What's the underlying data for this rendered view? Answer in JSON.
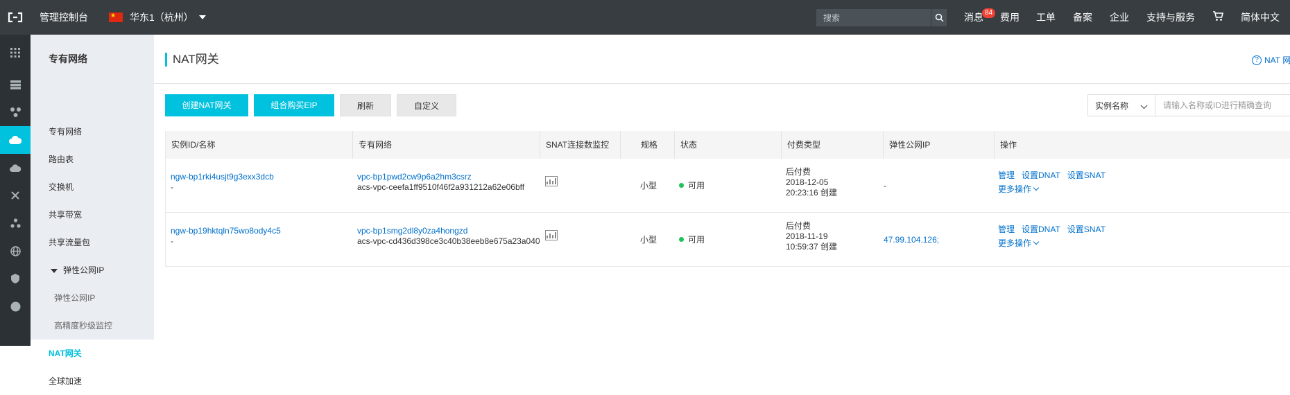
{
  "topbar": {
    "console_label": "管理控制台",
    "region_label": "华东1（杭州）",
    "search_placeholder": "搜索",
    "nav": {
      "messages": "消息",
      "messages_badge": "84",
      "fees": "费用",
      "tickets": "工单",
      "filing": "备案",
      "enterprise": "企业",
      "support": "支持与服务",
      "language": "简体中文"
    },
    "colors": {
      "background": "#373d41",
      "badge": "#f04134"
    }
  },
  "rail": {
    "icons": [
      "apps-grid-icon",
      "server-icon",
      "network-icon",
      "cloud-icon",
      "cdn-icon",
      "tools-icon",
      "cluster-icon",
      "globe-icon",
      "security-icon",
      "circle-icon"
    ],
    "active_index": 3,
    "accent": "#00c1de"
  },
  "sidebar": {
    "title": "专有网络",
    "items": [
      {
        "label": "专有网络"
      },
      {
        "label": "路由表"
      },
      {
        "label": "交换机"
      },
      {
        "label": "共享带宽"
      },
      {
        "label": "共享流量包"
      },
      {
        "label": "弹性公网IP"
      },
      {
        "label": "弹性公网IP"
      },
      {
        "label": "高精度秒级监控"
      },
      {
        "label": "NAT网关"
      },
      {
        "label": "全球加速"
      }
    ]
  },
  "main": {
    "title": "NAT网关",
    "help_link": "NAT 网",
    "buttons": {
      "create": "创建NAT网关",
      "buy_eip": "组合购买EIP",
      "refresh": "刷新",
      "customize": "自定义"
    },
    "filter": {
      "select_value": "实例名称",
      "input_placeholder": "请输入名称或ID进行精确查询"
    },
    "table": {
      "columns": [
        "实例ID/名称",
        "专有网络",
        "SNAT连接数监控",
        "规格",
        "状态",
        "付费类型",
        "弹性公网IP",
        "操作"
      ],
      "rows": [
        {
          "id": "ngw-bp1rki4usjt9g3exx3dcb",
          "name": "-",
          "vpc_id": "vpc-bp1pwd2cw9p6a2hm3csrz",
          "vpc_name": "acs-vpc-ceefa1ff9510f46f2a931212a62e06bff",
          "spec": "小型",
          "status": "可用",
          "billing": "后付费",
          "created_date": "2018-12-05",
          "created_time": "20:23:16 创建",
          "eip": "-",
          "ops": {
            "manage": "管理",
            "dnat": "设置DNAT",
            "snat": "设置SNAT",
            "more": "更多操作"
          }
        },
        {
          "id": "ngw-bp19hktqln75wo8ody4c5",
          "name": "-",
          "vpc_id": "vpc-bp1smg2dl8y0za4hongzd",
          "vpc_name": "acs-vpc-cd436d398ce3c40b38eeb8e675a23a040",
          "spec": "小型",
          "status": "可用",
          "billing": "后付费",
          "created_date": "2018-11-19",
          "created_time": "10:59:37 创建",
          "eip": "47.99.104.126;",
          "ops": {
            "manage": "管理",
            "dnat": "设置DNAT",
            "snat": "设置SNAT",
            "more": "更多操作"
          }
        }
      ]
    },
    "colors": {
      "primary": "#00c1de",
      "link": "#0070cc",
      "status_ok": "#1ec359"
    }
  }
}
